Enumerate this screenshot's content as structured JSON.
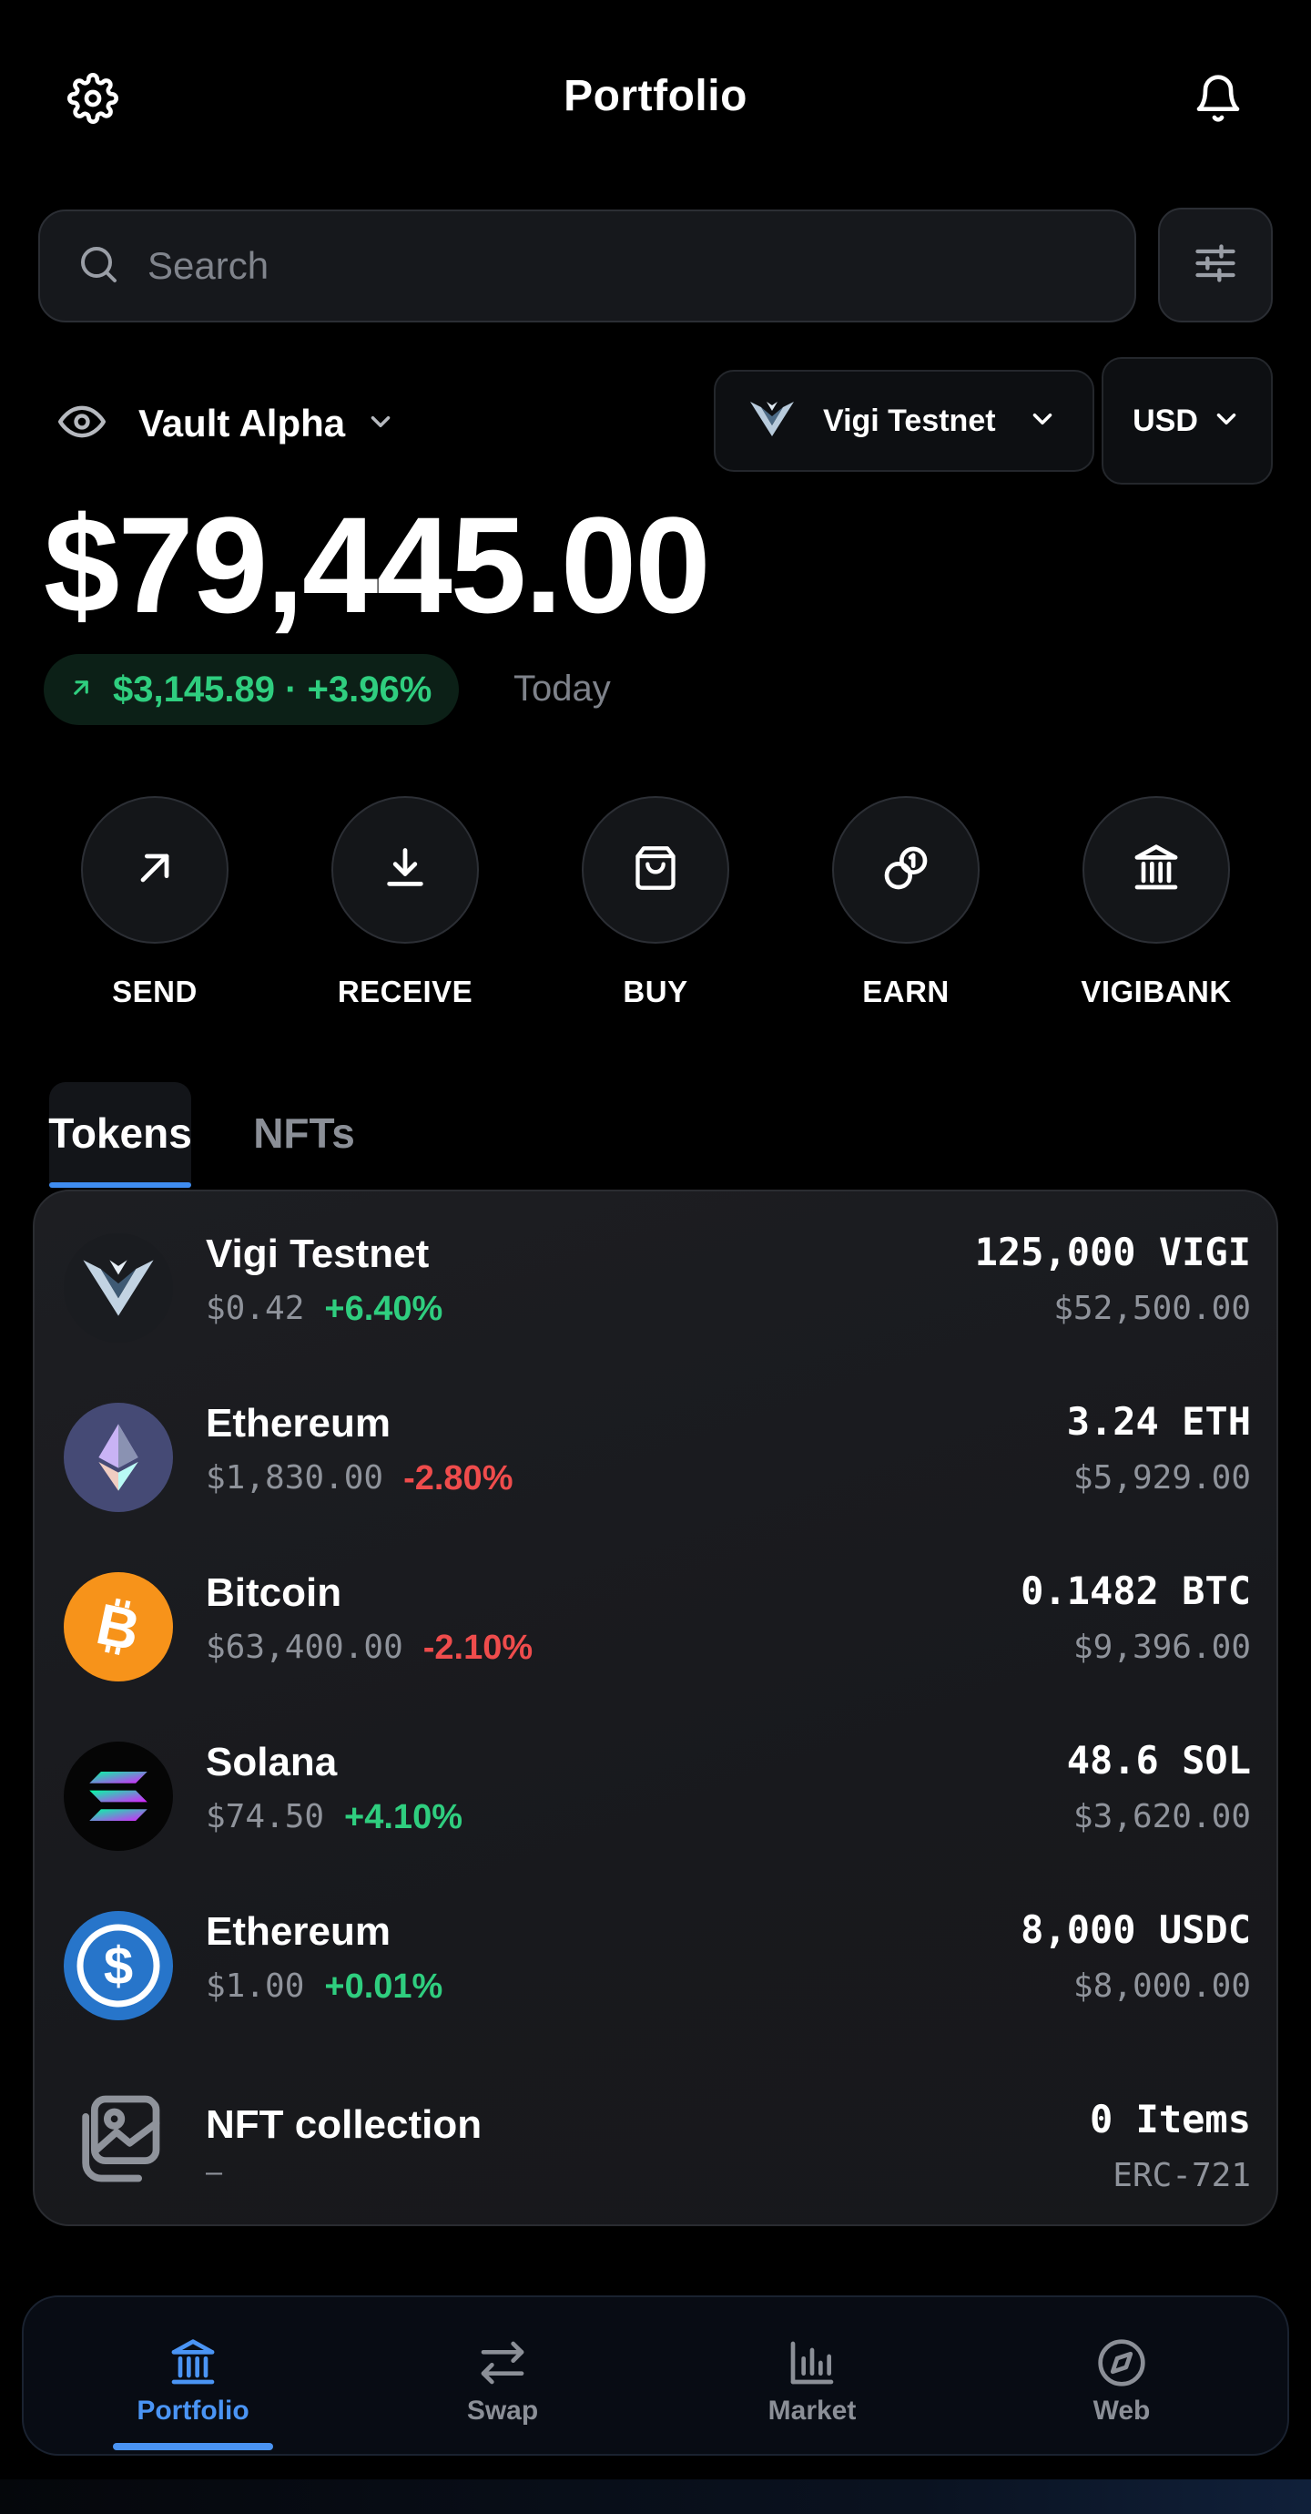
{
  "header": {
    "title": "Portfolio",
    "settings_icon": "gear-icon",
    "notifications_icon": "bell-icon"
  },
  "search": {
    "placeholder": "Search"
  },
  "wallet": {
    "name": "Vault Alpha"
  },
  "network": {
    "label": "Vigi Testnet"
  },
  "currency": {
    "label": "USD"
  },
  "balance": {
    "total": "$79,445.00",
    "change": "$3,145.89 · +3.96%",
    "period": "Today"
  },
  "actions": [
    {
      "label": "SEND",
      "icon": "arrow-up-right-icon"
    },
    {
      "label": "RECEIVE",
      "icon": "download-icon"
    },
    {
      "label": "BUY",
      "icon": "shopping-bag-icon"
    },
    {
      "label": "EARN",
      "icon": "coins-icon"
    },
    {
      "label": "VIGIBANK",
      "icon": "bank-icon"
    }
  ],
  "tabs": [
    {
      "label": "Tokens",
      "active": true
    },
    {
      "label": "NFTs",
      "active": false
    }
  ],
  "tokens": [
    {
      "name": "Vigi Testnet",
      "price": "$0.42",
      "change": "+6.40%",
      "amount": "125,000 VIGI",
      "value": "$52,500.00"
    },
    {
      "name": "Ethereum",
      "price": "$1,830.00",
      "change": "-2.80%",
      "amount": "3.24 ETH",
      "value": "$5,929.00"
    },
    {
      "name": "Bitcoin",
      "price": "$63,400.00",
      "change": "-2.10%",
      "amount": "0.1482 BTC",
      "value": "$9,396.00"
    },
    {
      "name": "Solana",
      "price": "$74.50",
      "change": "+4.10%",
      "amount": "48.6 SOL",
      "value": "$3,620.00"
    },
    {
      "name": "Ethereum",
      "price": "$1.00",
      "change": "+0.01%",
      "amount": "8,000 USDC",
      "value": "$8,000.00"
    },
    {
      "name": "NFT collection",
      "price": "—",
      "change": "",
      "amount": "0 Items",
      "value": "ERC-721"
    }
  ],
  "nav": [
    {
      "label": "Portfolio",
      "icon": "bank-icon",
      "active": true
    },
    {
      "label": "Swap",
      "icon": "swap-icon",
      "active": false
    },
    {
      "label": "Market",
      "icon": "bar-chart-icon",
      "active": false
    },
    {
      "label": "Web",
      "icon": "compass-icon",
      "active": false
    }
  ],
  "colors": {
    "positive": "#2fce7f",
    "negative": "#ef4c4c",
    "accent": "#4a94f4",
    "bitcoin": "#f7931a",
    "usdc": "#2775ca",
    "ethereum": "#454a75"
  }
}
